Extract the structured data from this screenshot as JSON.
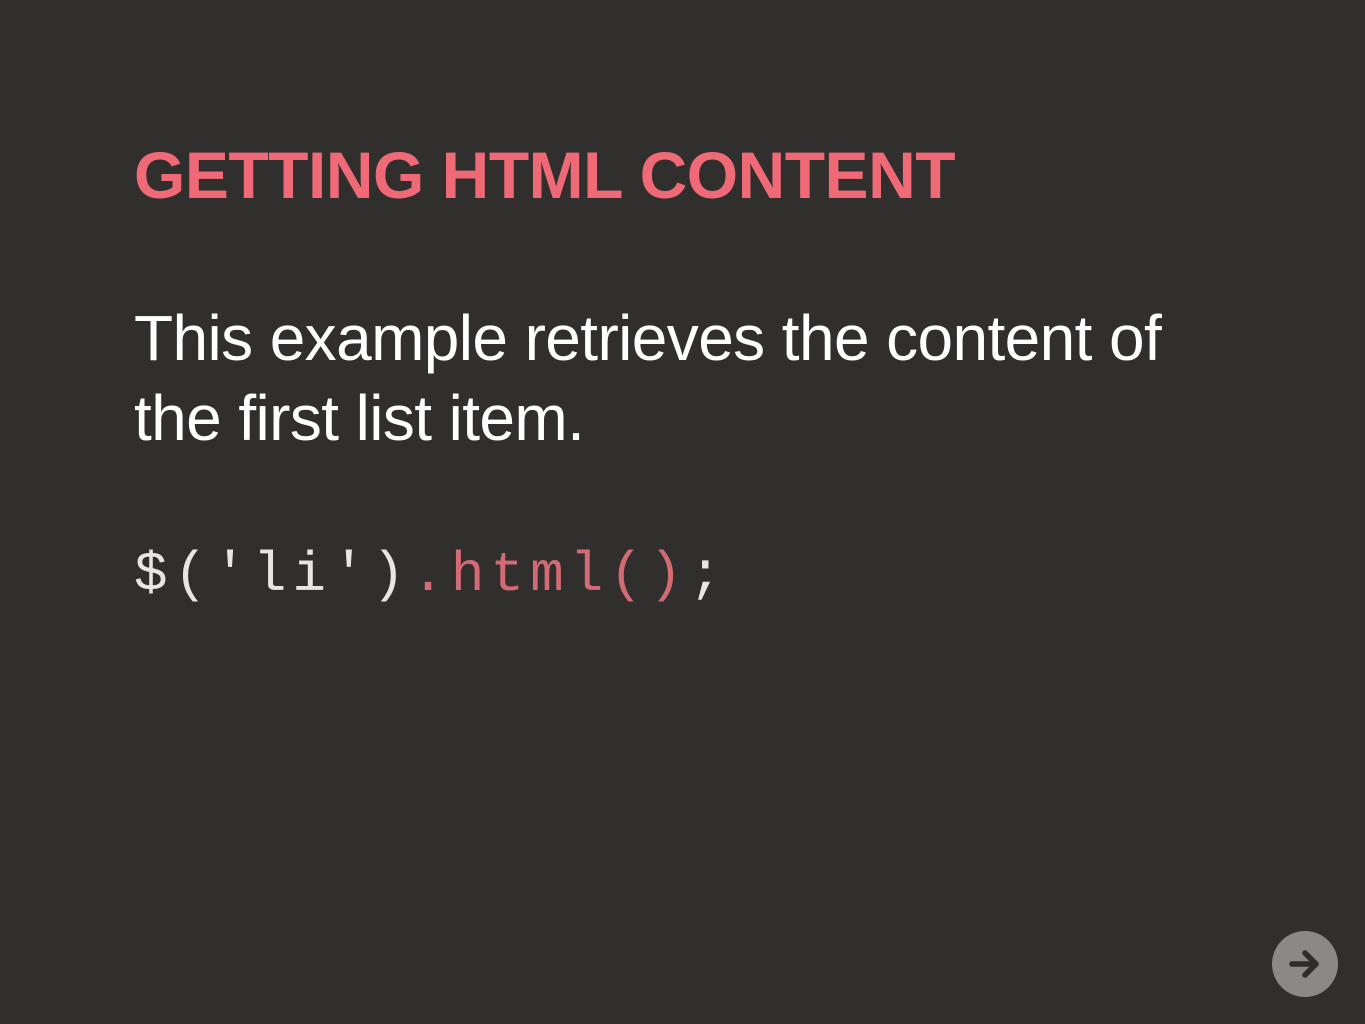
{
  "slide": {
    "title": "GETTING HTML CONTENT",
    "body": "This example retrieves the content of the first list item.",
    "code": {
      "selector": "$('li')",
      "method": ".html()",
      "terminator": ";"
    }
  },
  "navigation": {
    "next_icon": "arrow-right-icon"
  },
  "colors": {
    "background": "#312f2e",
    "accent": "#ef6a76",
    "text": "#ffffff",
    "code_text": "#e8e6e4",
    "code_accent": "#d46a74",
    "nav_button": "#8a8988",
    "nav_arrow": "#2f2d2c"
  }
}
